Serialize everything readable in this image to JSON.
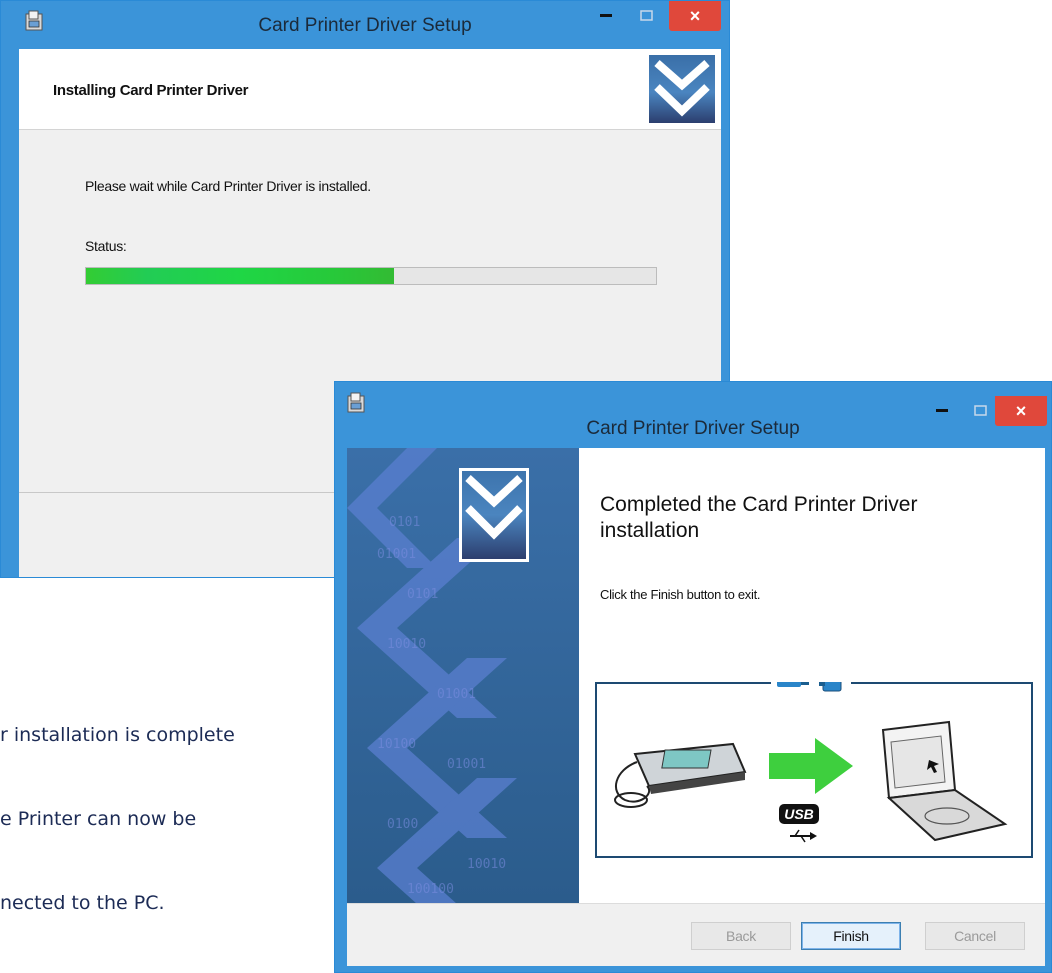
{
  "install_window": {
    "title": "Card Printer Driver Setup",
    "header_title": "Installing Card Printer Driver",
    "message": "Please wait while Card Printer Driver is installed.",
    "status_label": "Status:",
    "progress": 0.54,
    "close_glyph": "×"
  },
  "complete_window": {
    "title": "Card Printer Driver Setup",
    "heading": "Completed the Card Printer Driver installation",
    "subtext": "Click the Finish button to exit.",
    "usb_label": "USB",
    "close_glyph": "×",
    "buttons": {
      "back": "Back",
      "finish": "Finish",
      "cancel": "Cancel"
    },
    "banner_text": [
      "0101",
      "01001",
      "0101",
      "10010",
      "01001",
      "10100",
      "01001",
      "0100",
      "10010",
      "100100"
    ]
  },
  "caption": {
    "lines": [
      "r installation is complete",
      "e Printer can now be",
      "nected to the PC."
    ]
  },
  "colors": {
    "titlebar": "#3b94d9",
    "close_button": "#e0483b",
    "progress_green": "#22cc44",
    "banner_blue": "#2d5f8f"
  }
}
